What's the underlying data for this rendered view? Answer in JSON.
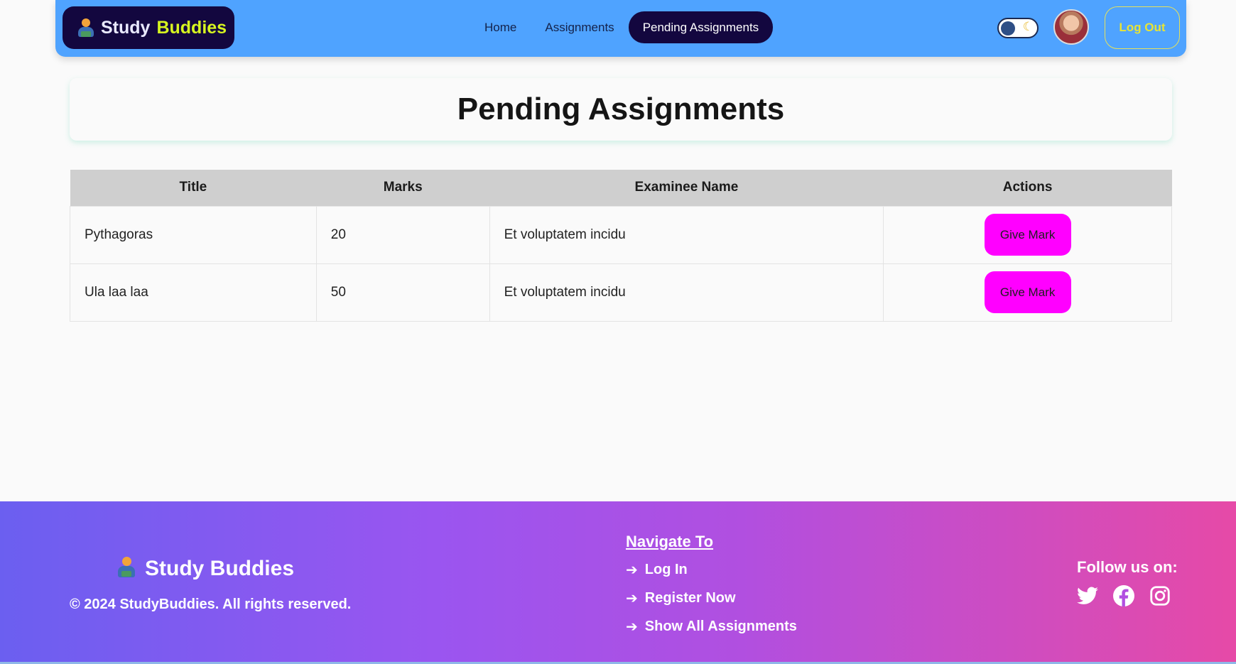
{
  "navbar": {
    "brand_study": "Study",
    "brand_buddies": "Buddies",
    "links": [
      {
        "label": "Home",
        "active": false
      },
      {
        "label": "Assignments",
        "active": false
      },
      {
        "label": "Pending Assignments",
        "active": true
      }
    ],
    "logout_label": "Log Out",
    "theme_toggle_icon": "moon-icon"
  },
  "page": {
    "title": "Pending Assignments"
  },
  "table": {
    "headers": [
      "Title",
      "Marks",
      "Examinee Name",
      "Actions"
    ],
    "rows": [
      {
        "title": "Pythagoras",
        "marks": "20",
        "examinee": "Et voluptatem incidu",
        "action_label": "Give Mark"
      },
      {
        "title": "Ula laa laa",
        "marks": "50",
        "examinee": "Et voluptatem incidu",
        "action_label": "Give Mark"
      }
    ]
  },
  "footer": {
    "brand": "Study Buddies",
    "copyright": "© 2024 StudyBuddies. All rights reserved.",
    "nav_title": "Navigate To",
    "nav_items": [
      "Log In",
      "Register Now",
      "Show All Assignments"
    ],
    "follow_title": "Follow us on:",
    "socials": [
      "twitter-icon",
      "facebook-icon",
      "instagram-icon"
    ]
  },
  "colors": {
    "navbar_bg": "#4fa3ff",
    "brand_bg": "#13073f",
    "brand_accent": "#d7f520",
    "action_button": "#ff00ff",
    "logout": "#e8e434"
  }
}
